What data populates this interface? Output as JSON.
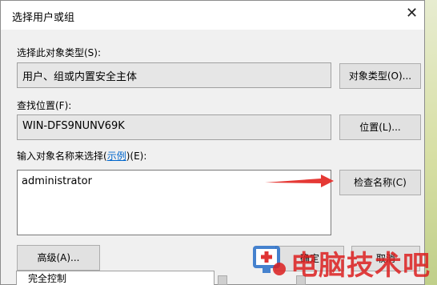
{
  "dialog": {
    "title": "选择用户或组",
    "close_glyph": "✕"
  },
  "object_type": {
    "label": "选择此对象类型(S):",
    "value": "用户、组或内置安全主体",
    "button": "对象类型(O)..."
  },
  "location": {
    "label": "查找位置(F):",
    "value": "WIN-DFS9NUNV69K",
    "button": "位置(L)..."
  },
  "names": {
    "label_prefix": "输入对象名称来选择(",
    "label_link": "示例",
    "label_suffix": ")(E):",
    "value": "administrator",
    "check_button": "检查名称(C)"
  },
  "footer": {
    "advanced_button": "高级(A)...",
    "ok_button": "确定",
    "cancel_button": "取消"
  },
  "background_list": {
    "item": "完全控制"
  },
  "watermark": {
    "text": "电脑技术吧"
  },
  "colors": {
    "arrow": "#e53935",
    "link": "#0066cc"
  }
}
